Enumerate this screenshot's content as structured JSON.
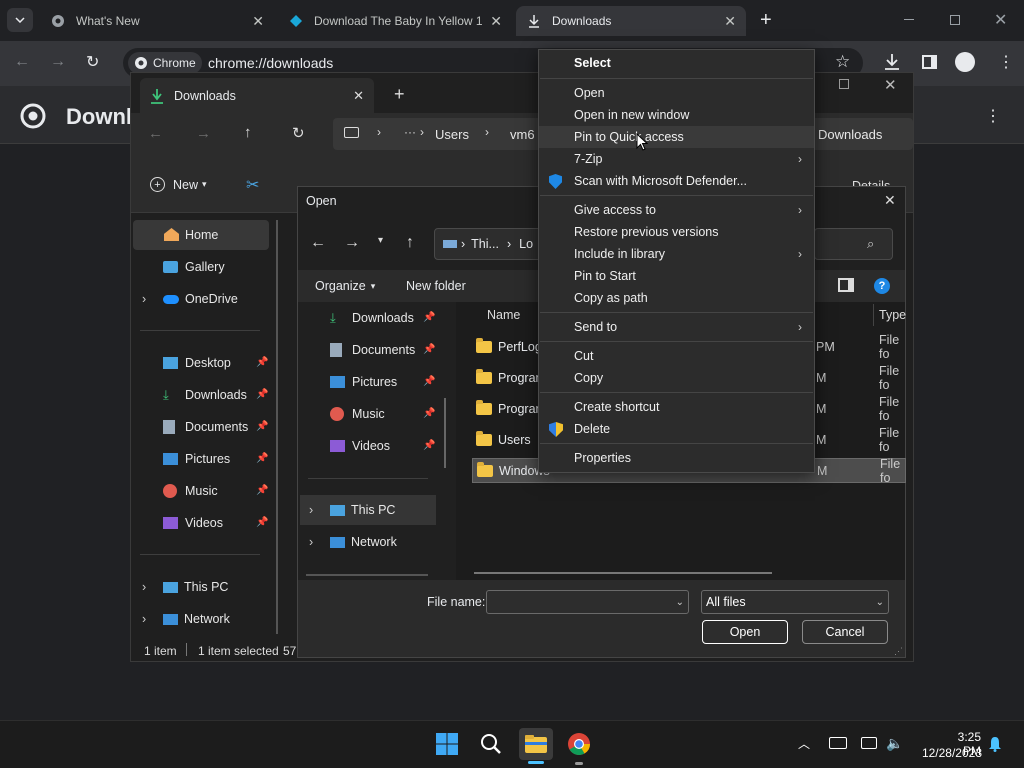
{
  "chrome": {
    "tabs": [
      {
        "label": "What's New",
        "close": "✕"
      },
      {
        "label": "Download The Baby In Yellow 1",
        "close": "✕"
      },
      {
        "label": "Downloads",
        "close": "✕"
      }
    ],
    "new_tab": "+",
    "omnibox_chip": "Chrome",
    "url": "chrome://downloads",
    "page_title": "Downloads"
  },
  "explorer": {
    "tab_label": "Downloads",
    "new_tab": "+",
    "breadcrumb": [
      "Users",
      "vm6"
    ],
    "breadcrumb_tail": "Downloads",
    "new_label": "New",
    "details_label": "Details",
    "nav": {
      "home": "Home",
      "gallery": "Gallery",
      "onedrive": "OneDrive",
      "quick": [
        "Desktop",
        "Downloads",
        "Documents",
        "Pictures",
        "Music",
        "Videos"
      ],
      "this_pc": "This PC",
      "network": "Network"
    },
    "status": {
      "items": "1 item",
      "selected": "1 item selected",
      "size": "57"
    }
  },
  "dialog": {
    "title": "Open",
    "address": [
      "Thi...",
      "Lo"
    ],
    "organize": "Organize",
    "new_folder": "New folder",
    "nav_items": [
      "Downloads",
      "Documents",
      "Pictures",
      "Music",
      "Videos"
    ],
    "this_pc": "This PC",
    "network": "Network",
    "columns": {
      "name": "Name",
      "type": "Type"
    },
    "rows": [
      {
        "name": "PerfLogs",
        "date": "PM",
        "type": "File fo"
      },
      {
        "name": "Program",
        "date": "M",
        "type": "File fo"
      },
      {
        "name": "Program",
        "date": "M",
        "type": "File fo"
      },
      {
        "name": "Users",
        "date": "M",
        "type": "File fo"
      },
      {
        "name": "Windows",
        "date": "M",
        "type": "File fo"
      }
    ],
    "filename_label": "File name:",
    "filename_value": "",
    "filter": "All files",
    "open_btn": "Open",
    "cancel_btn": "Cancel"
  },
  "context_menu": {
    "header": "Select",
    "items": [
      {
        "label": "Open"
      },
      {
        "label": "Open in new window"
      },
      {
        "label": "Pin to Quick access"
      },
      {
        "label": "7-Zip",
        "arrow": "›"
      },
      {
        "label": "Scan with Microsoft Defender..."
      },
      {
        "label": "Give access to",
        "arrow": "›"
      },
      {
        "label": "Restore previous versions"
      },
      {
        "label": "Include in library",
        "arrow": "›"
      },
      {
        "label": "Pin to Start"
      },
      {
        "label": "Copy as path"
      },
      {
        "label": "Send to",
        "arrow": "›"
      },
      {
        "label": "Cut"
      },
      {
        "label": "Copy"
      },
      {
        "label": "Create shortcut"
      },
      {
        "label": "Delete"
      },
      {
        "label": "Properties"
      }
    ]
  },
  "taskbar": {
    "time": "3:25 PM",
    "date": "12/28/2023"
  },
  "colors": {
    "accent": "#0078d4",
    "folder": "#f3c546",
    "download_green": "#3ec47a"
  }
}
